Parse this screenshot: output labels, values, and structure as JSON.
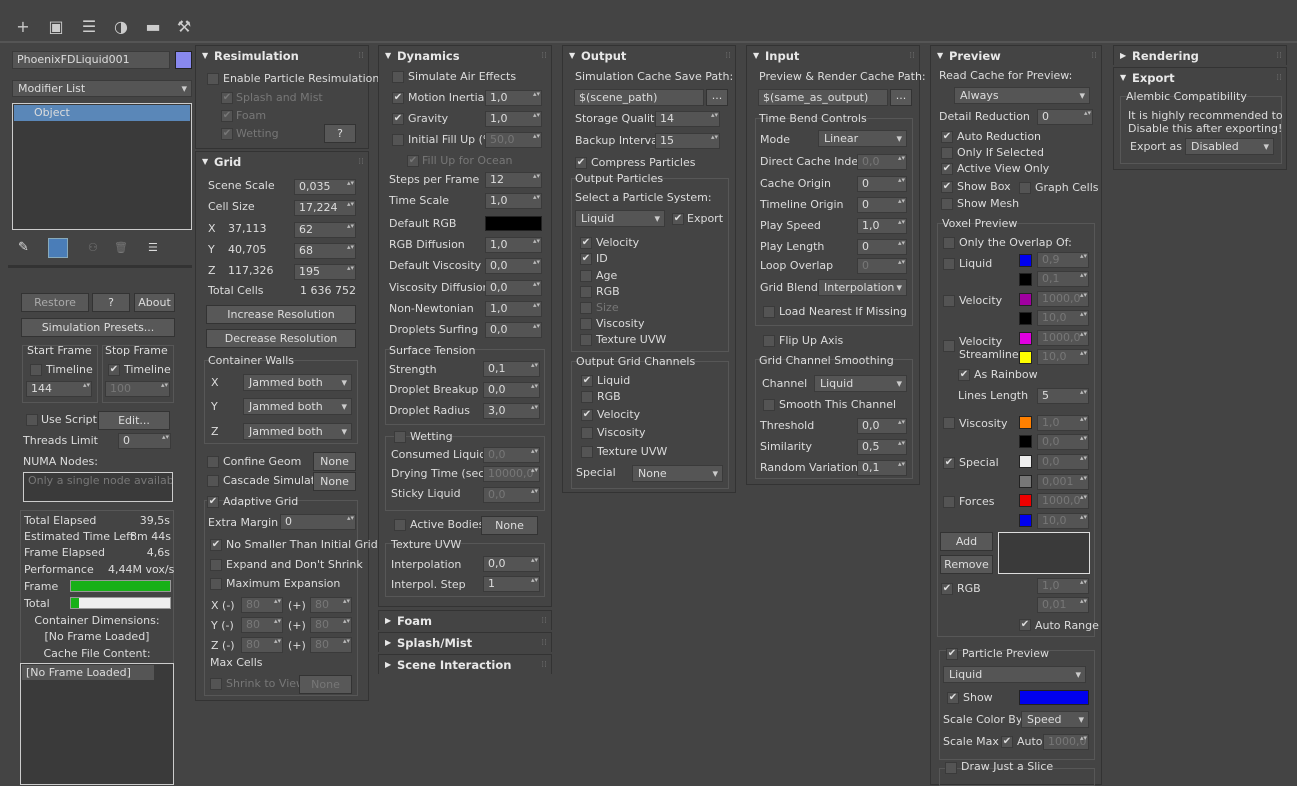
{
  "toolbar": {
    "icons": [
      "plus-icon",
      "select-region-icon",
      "hierarchy-icon",
      "motion-icon",
      "display-icon",
      "wrench-icon"
    ],
    "glyphs": [
      "+",
      "▣",
      "☰",
      "◑",
      "▬",
      "⚒"
    ]
  },
  "left": {
    "object_name": "PhoenixFDLiquid001",
    "object_color": "#8888ee",
    "modifier_list": "Modifier List",
    "stack_item": "Object",
    "restore": "Restore",
    "help": "?",
    "about": "About",
    "sim_presets": "Simulation Presets...",
    "start_frame": "Start Frame",
    "stop_frame": "Stop Frame",
    "timeline": "Timeline",
    "start_value": "144",
    "stop_value": "100",
    "use_script": "Use Script",
    "edit": "Edit...",
    "threads_limit": "Threads Limit",
    "threads_value": "0",
    "numa_nodes": "NUMA Nodes:",
    "numa_placeholder": "Only a single node available.",
    "total_elapsed": "Total Elapsed",
    "total_elapsed_v": "39,5s",
    "time_left": "Estimated Time Left",
    "time_left_v": "8m 44s",
    "frame_elapsed": "Frame Elapsed",
    "frame_elapsed_v": "4,6s",
    "performance": "Performance",
    "performance_v": "4,44M vox/s",
    "frame": "Frame",
    "total": "Total",
    "frame_progress": 1.0,
    "total_progress": 0.08,
    "container_dims": "Container Dimensions:",
    "no_frame": "[No Frame Loaded]",
    "cache_content": "Cache File Content:",
    "list_item": "[No Frame Loaded]"
  },
  "resim": {
    "title": "Resimulation",
    "enable": "Enable Particle Resimulation",
    "splash": "Splash and Mist",
    "foam": "Foam",
    "wetting": "Wetting",
    "help": "?"
  },
  "grid": {
    "title": "Grid",
    "scene_scale": "Scene Scale",
    "scene_scale_v": "0,035",
    "cell_size": "Cell Size",
    "cell_size_v": "17,224",
    "x": "X",
    "x_v": "37,113",
    "x_n": "62",
    "y": "Y",
    "y_v": "40,705",
    "y_n": "68",
    "z": "Z",
    "z_v": "117,326",
    "z_n": "195",
    "total_cells": "Total Cells",
    "total_cells_v": "1 636 752",
    "increase": "Increase Resolution",
    "decrease": "Decrease Resolution",
    "container_walls": "Container Walls",
    "wall_x": "X",
    "wall_y": "Y",
    "wall_z": "Z",
    "jammed": "Jammed both",
    "confine": "Confine Geom",
    "cascade": "Cascade Simulator",
    "none": "None",
    "adaptive": "Adaptive Grid",
    "extra_margin": "Extra Margin",
    "extra_margin_v": "0",
    "no_smaller": "No Smaller Than Initial Grid",
    "expand": "Expand and Don't Shrink",
    "max_exp": "Maximum Expansion",
    "xm": "X (-)",
    "ym": "Y (-)",
    "zm": "Z (-)",
    "plus": "(+)",
    "v80": "80",
    "max_cells": "Max Cells",
    "shrink": "Shrink to View"
  },
  "dyn": {
    "title": "Dynamics",
    "air": "Simulate Air Effects",
    "motion": "Motion Inertia",
    "motion_v": "1,0",
    "gravity": "Gravity",
    "gravity_v": "1,0",
    "fill": "Initial Fill Up (%)",
    "fill_v": "50,0",
    "fill_ocean": "Fill Up for Ocean",
    "steps": "Steps per Frame",
    "steps_v": "12",
    "time_scale": "Time Scale",
    "time_scale_v": "1,0",
    "def_rgb": "Default RGB",
    "rgb_diff": "RGB Diffusion",
    "rgb_diff_v": "1,0",
    "def_visc": "Default Viscosity",
    "def_visc_v": "0,0",
    "visc_diff": "Viscosity Diffusion",
    "visc_diff_v": "0,0",
    "nonnewt": "Non-Newtonian",
    "nonnewt_v": "1,0",
    "droplets": "Droplets Surfing",
    "droplets_v": "0,0",
    "surf_tension": "Surface Tension",
    "strength": "Strength",
    "strength_v": "0,1",
    "breakup": "Droplet Breakup",
    "breakup_v": "0,0",
    "radius": "Droplet Radius",
    "radius_v": "3,0",
    "wetting": "Wetting",
    "consumed": "Consumed Liquid",
    "consumed_v": "0,0",
    "drying": "Drying Time (sec)",
    "drying_v": "10000,0",
    "sticky": "Sticky Liquid",
    "sticky_v": "0,0",
    "active": "Active Bodies",
    "none": "None",
    "tex_uvw": "Texture UVW",
    "interp": "Interpolation",
    "interp_v": "0,0",
    "interp_step": "Interpol. Step",
    "interp_step_v": "1"
  },
  "collapsed": {
    "foam": "Foam",
    "splash": "Splash/Mist",
    "scene": "Scene Interaction",
    "rendering": "Rendering"
  },
  "out": {
    "title": "Output",
    "path_label": "Simulation Cache Save Path:",
    "path": "$(scene_path)",
    "browse": "...",
    "quality": "Storage Quality",
    "quality_v": "14",
    "backup": "Backup Interval",
    "backup_v": "15",
    "compress": "Compress Particles",
    "out_particles": "Output Particles",
    "select_sys": "Select a Particle System:",
    "sys": "Liquid",
    "export": "Export",
    "velocity": "Velocity",
    "id": "ID",
    "age": "Age",
    "rgb": "RGB",
    "size": "Size",
    "viscosity": "Viscosity",
    "tex": "Texture UVW",
    "grid_channels": "Output Grid Channels",
    "liquid": "Liquid",
    "special": "Special",
    "special_v": "None"
  },
  "inp": {
    "title": "Input",
    "path_label": "Preview & Render Cache Path:",
    "path": "$(same_as_output)",
    "browse": "...",
    "tbc": "Time Bend Controls",
    "mode": "Mode",
    "mode_v": "Linear",
    "dci": "Direct Cache Index",
    "dci_v": "0,0",
    "cache_origin": "Cache Origin",
    "cache_origin_v": "0",
    "tl_origin": "Timeline Origin",
    "tl_origin_v": "0",
    "play_speed": "Play Speed",
    "play_speed_v": "1,0",
    "play_length": "Play Length",
    "play_length_v": "0",
    "loop": "Loop Overlap",
    "loop_v": "0",
    "grid_blend": "Grid Blend",
    "grid_blend_v": "Interpolation",
    "load_nearest": "Load Nearest If Missing",
    "flip": "Flip Up Axis",
    "gcs": "Grid Channel Smoothing",
    "channel": "Channel",
    "channel_v": "Liquid",
    "smooth": "Smooth This Channel",
    "threshold": "Threshold",
    "threshold_v": "0,0",
    "similarity": "Similarity",
    "similarity_v": "0,5",
    "random": "Random Variation",
    "random_v": "0,1"
  },
  "prev": {
    "title": "Preview",
    "read_cache": "Read Cache for Preview:",
    "read_v": "Always",
    "detail": "Detail Reduction",
    "detail_v": "0",
    "auto_red": "Auto Reduction",
    "only_sel": "Only If Selected",
    "active_view": "Active View Only",
    "show_box": "Show Box",
    "graph": "Graph Cells",
    "show_mesh": "Show Mesh",
    "voxel": "Voxel Preview",
    "overlap": "Only the Overlap Of:",
    "liquid": "Liquid",
    "velocity": "Velocity",
    "vstream": "Velocity",
    "vstream2": "Streamlines",
    "rainbow": "As Rainbow",
    "lines_len": "Lines Length",
    "lines_len_v": "5",
    "viscosity": "Viscosity",
    "special": "Special",
    "forces": "Forces",
    "add": "Add",
    "remove": "Remove",
    "rgb": "RGB",
    "auto_range": "Auto Range",
    "v09": "0,9",
    "v01": "0,1",
    "v1000": "1000,0",
    "v10": "10,0",
    "v10a": "1,0",
    "v00": "0,0",
    "v0001": "0,001",
    "v001": "0,01",
    "part_prev": "Particle Preview",
    "part_sys": "Liquid",
    "show": "Show",
    "scale_color": "Scale Color By",
    "scale_color_v": "Speed",
    "scale_max": "Scale Max",
    "auto": "Auto",
    "scale_max_v": "1000,0",
    "slice": "Draw Just a Slice"
  },
  "exp": {
    "title": "Export",
    "alembic": "Alembic Compatibility",
    "msg1": "It is highly recommended to",
    "msg2": "Disable this after exporting!",
    "export_as": "Export as",
    "export_v": "Disabled"
  }
}
